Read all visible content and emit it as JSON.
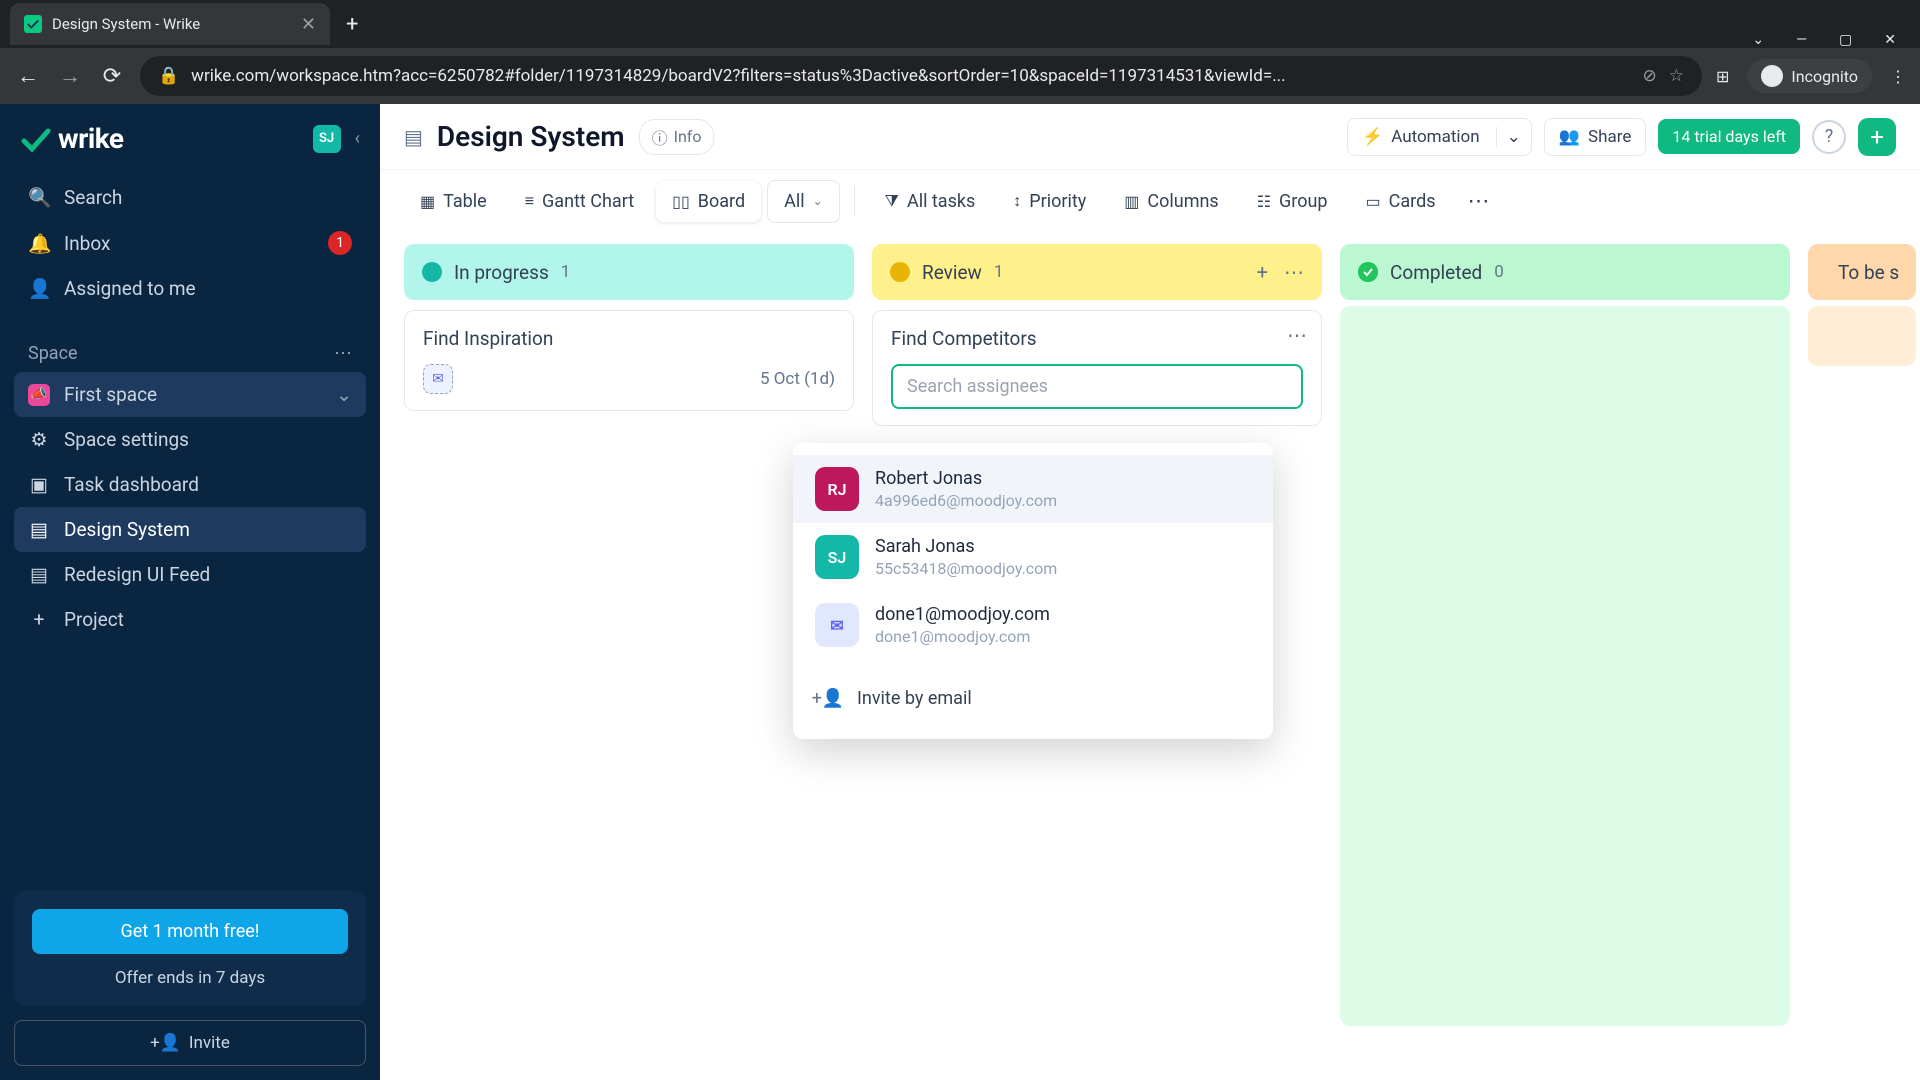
{
  "browser": {
    "tab_title": "Design System - Wrike",
    "url": "wrike.com/workspace.htm?acc=6250782#folder/1197314829/boardV2?filters=status%3Dactive&sortOrder=10&spaceId=1197314531&viewId=...",
    "incognito_label": "Incognito"
  },
  "sidebar": {
    "logo_text": "wrike",
    "user_initials": "SJ",
    "nav": {
      "search": "Search",
      "inbox": "Inbox",
      "inbox_badge": "1",
      "assigned": "Assigned to me"
    },
    "space_label": "Space",
    "space_name": "First space",
    "items": {
      "settings": "Space settings",
      "dashboard": "Task dashboard",
      "design_system": "Design System",
      "redesign": "Redesign UI Feed",
      "project": "Project"
    },
    "promo_btn": "Get 1 month free!",
    "promo_sub": "Offer ends in 7 days",
    "invite": "Invite"
  },
  "header": {
    "title": "Design System",
    "info": "Info",
    "automation": "Automation",
    "share": "Share",
    "trial": "14 trial days left"
  },
  "viewbar": {
    "table": "Table",
    "gantt": "Gantt Chart",
    "board": "Board",
    "all": "All",
    "all_tasks": "All tasks",
    "priority": "Priority",
    "columns": "Columns",
    "group": "Group",
    "cards": "Cards"
  },
  "columns": {
    "in_progress": {
      "label": "In progress",
      "count": "1"
    },
    "review": {
      "label": "Review",
      "count": "1"
    },
    "completed": {
      "label": "Completed",
      "count": "0"
    },
    "tobe": {
      "label": "To be s"
    }
  },
  "cards": {
    "inspiration": {
      "title": "Find Inspiration",
      "date": "5 Oct (1d)"
    },
    "competitors": {
      "title": "Find Competitors"
    }
  },
  "assignee_popover": {
    "placeholder": "Search assignees",
    "people": [
      {
        "initials": "RJ",
        "name": "Robert Jonas",
        "email": "4a996ed6@moodjoy.com"
      },
      {
        "initials": "SJ",
        "name": "Sarah Jonas",
        "email": "55c53418@moodjoy.com"
      },
      {
        "initials": "✉",
        "name": "done1@moodjoy.com",
        "email": "done1@moodjoy.com"
      }
    ],
    "invite": "Invite by email"
  }
}
